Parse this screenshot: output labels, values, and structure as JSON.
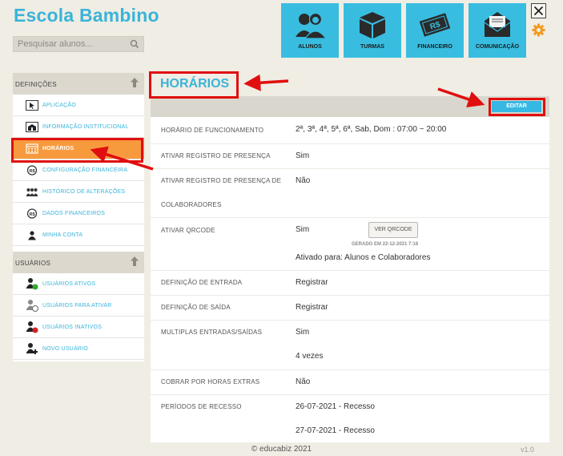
{
  "app": {
    "title": "Escola Bambino",
    "search_placeholder": "Pesquisar alunos..."
  },
  "modules": [
    {
      "label": "ALUNOS",
      "icon": "students-icon"
    },
    {
      "label": "TURMAS",
      "icon": "box-icon"
    },
    {
      "label": "FINANCEIRO",
      "icon": "money-icon"
    },
    {
      "label": "COMUNICAÇÃO",
      "icon": "envelope-icon"
    }
  ],
  "sidebar": {
    "definicoes_header": "DEFINIÇÕES",
    "definicoes": [
      {
        "label": "APLICAÇÃO",
        "icon": "cursor-icon",
        "active": false
      },
      {
        "label": "INFORMAÇÃO INSTITUCIONAL",
        "icon": "institution-icon",
        "active": false
      },
      {
        "label": "HORÁRIOS",
        "icon": "calendar-icon",
        "active": true
      },
      {
        "label": "CONFIGURAÇÃO FINANCEIRA",
        "icon": "currency-icon",
        "active": false
      },
      {
        "label": "HISTÓRICO DE ALTERAÇÕES",
        "icon": "group-icon",
        "active": false
      },
      {
        "label": "DADOS FINANCEIROS",
        "icon": "currency-icon",
        "active": false
      },
      {
        "label": "MINHA CONTA",
        "icon": "user-icon",
        "active": false
      }
    ],
    "usuarios_header": "USUÁRIOS",
    "usuarios": [
      {
        "label": "USUÁRIOS ATIVOS",
        "icon": "user-active-icon"
      },
      {
        "label": "USUÁRIOS PARA ATIVAR",
        "icon": "user-pending-icon"
      },
      {
        "label": "USUÁRIOS INATIVOS",
        "icon": "user-inactive-icon"
      },
      {
        "label": "NOVO USUÁRIO",
        "icon": "user-add-icon"
      }
    ]
  },
  "content": {
    "title": "HORÁRIOS",
    "edit_label": "EDITAR",
    "rows": [
      {
        "key": "HORÁRIO DE FUNCIONAMENTO",
        "value": "2ª, 3ª, 4ª, 5ª, 6ª, Sab, Dom : 07:00 ~ 20:00"
      },
      {
        "key": "ATIVAR REGISTRO DE PRESENÇA",
        "value": "Sim"
      },
      {
        "key": "ATIVAR REGISTRO DE PRESENÇA DE",
        "key2": "COLABORADORES",
        "value": "Não"
      },
      {
        "key": "ATIVAR QRCODE",
        "value": "Sim",
        "button": "VER QRCODE",
        "generated": "GERADO EM 22-12-2021 7:18",
        "value2": "Ativado para: Alunos e Colaboradores"
      },
      {
        "key": "DEFINIÇÃO DE ENTRADA",
        "value": "Registrar"
      },
      {
        "key": "DEFINIÇÃO DE SAÍDA",
        "value": "Registrar"
      },
      {
        "key": "MULTIPLAS ENTRADAS/SAÍDAS",
        "value": "Sim",
        "value2": "4 vezes"
      },
      {
        "key": "COBRAR POR HORAS EXTRAS",
        "value": "Não"
      },
      {
        "key": "PERÍODOS DE RECESSO",
        "value": "26-07-2021 - Recesso",
        "value2": "27-07-2021 - Recesso"
      }
    ]
  },
  "footer": {
    "copyright": "© educabiz 2021",
    "version": "v1.0"
  },
  "colors": {
    "accent": "#3ab4d9",
    "module_bg": "#38bde0",
    "active_item": "#f79a3e",
    "annotation": "#e00e0e",
    "background": "#f0ede4"
  }
}
